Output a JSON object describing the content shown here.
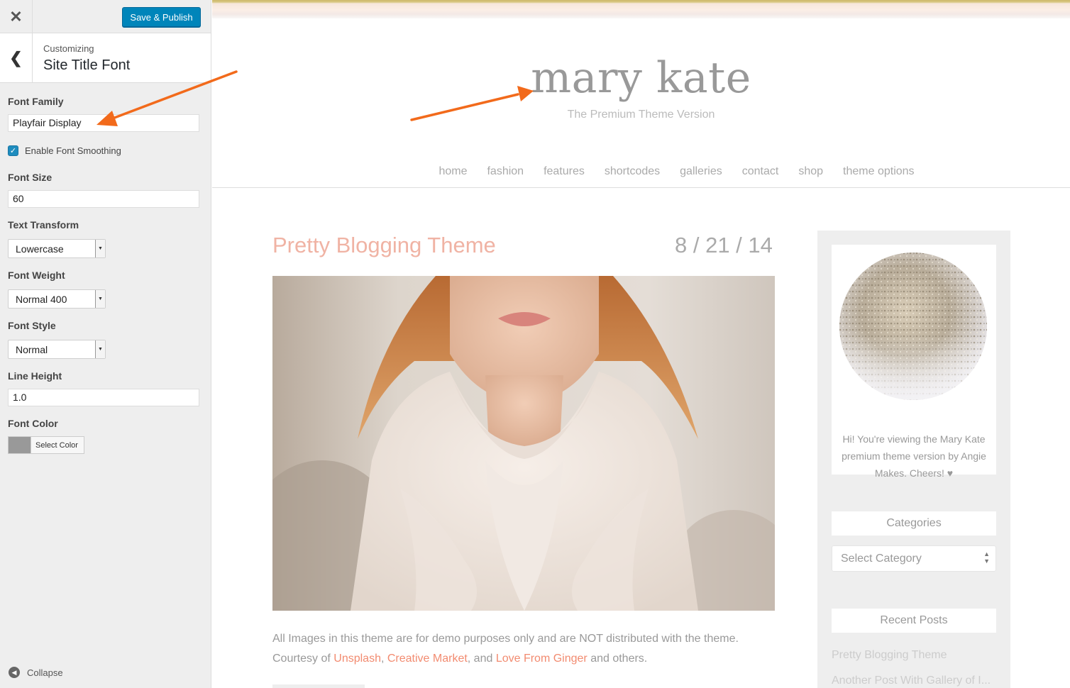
{
  "customizer": {
    "save_label": "Save & Publish",
    "close_glyph": "✕",
    "back_glyph": "❮",
    "breadcrumb_small": "Customizing",
    "section_title": "Site Title Font",
    "font_family_label": "Font Family",
    "font_family_value": "Playfair Display",
    "smoothing_label": "Enable Font Smoothing",
    "smoothing_checked": true,
    "font_size_label": "Font Size",
    "font_size_value": "60",
    "text_transform_label": "Text Transform",
    "text_transform_value": "Lowercase",
    "font_weight_label": "Font Weight",
    "font_weight_value": "Normal 400",
    "font_style_label": "Font Style",
    "font_style_value": "Normal",
    "line_height_label": "Line Height",
    "line_height_value": "1.0",
    "font_color_label": "Font Color",
    "font_color_button": "Select Color",
    "font_color_swatch": "#999999",
    "collapse_label": "Collapse"
  },
  "preview": {
    "site_title": "mary kate",
    "tagline": "The Premium Theme Version",
    "nav": [
      "home",
      "fashion",
      "features",
      "shortcodes",
      "galleries",
      "contact",
      "shop",
      "theme options"
    ],
    "post": {
      "title": "Pretty Blogging Theme",
      "date": "8 / 21 / 14",
      "text_before": "All Images in this theme are for demo purposes only and are NOT distributed with the theme.  Courtesy of ",
      "link1": "Unsplash",
      "sep1": ", ",
      "link2": "Creative Market",
      "sep2": ", and ",
      "link3": "Love From Ginger",
      "text_after": " and others."
    },
    "sidebar": {
      "about_text": "Hi! You're viewing the Mary Kate premium theme version by Angie Makes. Cheers! ♥",
      "categories_title": "Categories",
      "categories_select": "Select Category",
      "recent_title": "Recent Posts",
      "recent_posts": [
        "Pretty Blogging Theme",
        "Another Post With Gallery of I..."
      ]
    }
  },
  "colors": {
    "accent_blue": "#0085ba",
    "post_title": "#f0b3a4",
    "link": "#f28b70",
    "annotation_arrow": "#f26a1b"
  }
}
